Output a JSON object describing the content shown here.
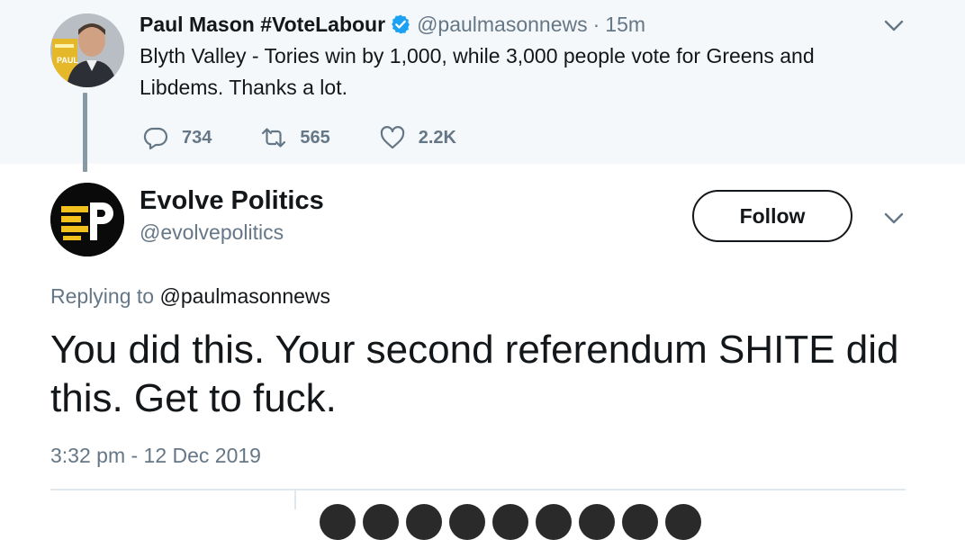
{
  "parent_tweet": {
    "author_name": "Paul Mason #VoteLabour",
    "handle": "@paulmasonnews",
    "separator": "·",
    "time": "15m",
    "text": "Blyth Valley - Tories win by 1,000, while 3,000 people vote for Greens and Libdems. Thanks a lot.",
    "replies": "734",
    "retweets": "565",
    "likes": "2.2K",
    "avatar_badge_text": "PAUL"
  },
  "reply_tweet": {
    "author_name": "Evolve Politics",
    "handle": "@evolvepolitics",
    "follow_label": "Follow",
    "replying_prefix": "Replying to",
    "replying_mention": "@paulmasonnews",
    "text": "You did this. Your second referendum SHITE did this. Get to fuck.",
    "timestamp": "3:32 pm - 12 Dec 2019"
  },
  "colors": {
    "text_primary": "#14171a",
    "text_secondary": "#657786",
    "parent_background": "#f5f8fa",
    "verified_blue": "#1da1f2",
    "divider": "#e1e8ed"
  },
  "icons": {
    "verified": "verified-badge-icon",
    "reply": "reply-bubble-icon",
    "retweet": "retweet-icon",
    "like": "heart-icon",
    "menu": "chevron-down-icon"
  }
}
